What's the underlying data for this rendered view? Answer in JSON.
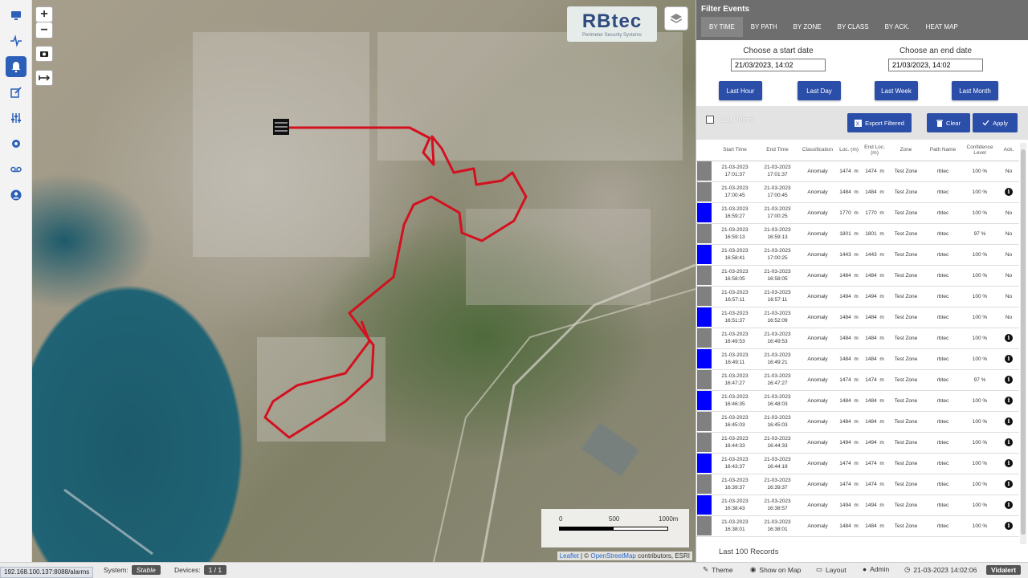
{
  "sidebar": [
    {
      "name": "monitor-icon",
      "active": false
    },
    {
      "name": "activity-icon",
      "active": false
    },
    {
      "name": "bell-icon",
      "active": true
    },
    {
      "name": "edit-icon",
      "active": false
    },
    {
      "name": "sliders-icon",
      "active": false
    },
    {
      "name": "gear-icon",
      "active": false
    },
    {
      "name": "voicemail-icon",
      "active": false
    },
    {
      "name": "user-icon",
      "active": false
    }
  ],
  "map": {
    "zoom_in": "+",
    "zoom_out": "−",
    "logo_text": "RBtec",
    "logo_sub": "Perimeter Security Systems",
    "scale": {
      "l0": "0",
      "l1": "500",
      "l2": "1000m"
    },
    "attribution": {
      "leaflet": "Leaflet",
      "sep": " | © ",
      "osm": "OpenStreetMap",
      "rest": " contributors, ESRI"
    }
  },
  "panel": {
    "title": "Filter Events",
    "tabs": [
      "BY TIME",
      "BY PATH",
      "BY ZONE",
      "BY CLASS",
      "BY ACK.",
      "HEAT MAP"
    ],
    "start": {
      "caption": "Choose a start date",
      "value": "21/03/2023, 14:02"
    },
    "end": {
      "caption": "Choose an end date",
      "value": "21/03/2023, 14:02"
    },
    "quick": [
      "Last Hour",
      "Last Day",
      "Last Week",
      "Last Month"
    ],
    "cal_points": "Cal. Points",
    "export": "Export Filtered",
    "clear": "Clear",
    "apply": "Apply",
    "footer": "Last 100 Records"
  },
  "table": {
    "headers": [
      "",
      "Start Time",
      "End Time",
      "Classification",
      "Loc. (m)",
      "End Loc. (m)",
      "Zone",
      "Path Name",
      "Confidence Level",
      "Ack."
    ],
    "rows": [
      {
        "color": "#808080",
        "start": [
          "21-03-2023",
          "17:01:37"
        ],
        "end": [
          "21-03-2023",
          "17:01:37"
        ],
        "cls": "Anomaly",
        "loc": "1474",
        "end_loc": "1474",
        "zone": "Test Zone",
        "path": "rbtec",
        "conf": "100 %",
        "ack": "No"
      },
      {
        "color": "#808080",
        "start": [
          "21-03-2023",
          "17:00:45"
        ],
        "end": [
          "21-03-2023",
          "17:00:45"
        ],
        "cls": "Anomaly",
        "loc": "1484",
        "end_loc": "1484",
        "zone": "Test Zone",
        "path": "rbtec",
        "conf": "100 %",
        "ack": "i"
      },
      {
        "color": "#0000ff",
        "start": [
          "21-03-2023",
          "16:59:27"
        ],
        "end": [
          "21-03-2023",
          "17:00:25"
        ],
        "cls": "Anomaly",
        "loc": "1770",
        "end_loc": "1770",
        "zone": "Test Zone",
        "path": "rbtec",
        "conf": "100 %",
        "ack": "No"
      },
      {
        "color": "#808080",
        "start": [
          "21-03-2023",
          "16:59:13"
        ],
        "end": [
          "21-03-2023",
          "16:59:13"
        ],
        "cls": "Anomaly",
        "loc": "1801",
        "end_loc": "1801",
        "zone": "Test Zone",
        "path": "rbtec",
        "conf": "97 %",
        "ack": "No"
      },
      {
        "color": "#0000ff",
        "start": [
          "21-03-2023",
          "16:58:41"
        ],
        "end": [
          "21-03-2023",
          "17:00:25"
        ],
        "cls": "Anomaly",
        "loc": "1443",
        "end_loc": "1443",
        "zone": "Test Zone",
        "path": "rbtec",
        "conf": "100 %",
        "ack": "No"
      },
      {
        "color": "#808080",
        "start": [
          "21-03-2023",
          "16:58:05"
        ],
        "end": [
          "21-03-2023",
          "16:58:05"
        ],
        "cls": "Anomaly",
        "loc": "1484",
        "end_loc": "1484",
        "zone": "Test Zone",
        "path": "rbtec",
        "conf": "100 %",
        "ack": "No"
      },
      {
        "color": "#808080",
        "start": [
          "21-03-2023",
          "16:57:11"
        ],
        "end": [
          "21-03-2023",
          "16:57:11"
        ],
        "cls": "Anomaly",
        "loc": "1494",
        "end_loc": "1494",
        "zone": "Test Zone",
        "path": "rbtec",
        "conf": "100 %",
        "ack": "No"
      },
      {
        "color": "#0000ff",
        "start": [
          "21-03-2023",
          "16:51:37"
        ],
        "end": [
          "21-03-2023",
          "16:52:09"
        ],
        "cls": "Anomaly",
        "loc": "1484",
        "end_loc": "1484",
        "zone": "Test Zone",
        "path": "rbtec",
        "conf": "100 %",
        "ack": "No"
      },
      {
        "color": "#808080",
        "start": [
          "21-03-2023",
          "16:49:53"
        ],
        "end": [
          "21-03-2023",
          "16:49:53"
        ],
        "cls": "Anomaly",
        "loc": "1484",
        "end_loc": "1484",
        "zone": "Test Zone",
        "path": "rbtec",
        "conf": "100 %",
        "ack": "i"
      },
      {
        "color": "#0000ff",
        "start": [
          "21-03-2023",
          "16:49:11"
        ],
        "end": [
          "21-03-2023",
          "16:49:21"
        ],
        "cls": "Anomaly",
        "loc": "1484",
        "end_loc": "1484",
        "zone": "Test Zone",
        "path": "rbtec",
        "conf": "100 %",
        "ack": "i"
      },
      {
        "color": "#808080",
        "start": [
          "21-03-2023",
          "16:47:27"
        ],
        "end": [
          "21-03-2023",
          "16:47:27"
        ],
        "cls": "Anomaly",
        "loc": "1474",
        "end_loc": "1474",
        "zone": "Test Zone",
        "path": "rbtec",
        "conf": "97 %",
        "ack": "i"
      },
      {
        "color": "#0000ff",
        "start": [
          "21-03-2023",
          "16:46:35"
        ],
        "end": [
          "21-03-2023",
          "16:48:03"
        ],
        "cls": "Anomaly",
        "loc": "1484",
        "end_loc": "1484",
        "zone": "Test Zone",
        "path": "rbtec",
        "conf": "100 %",
        "ack": "i"
      },
      {
        "color": "#808080",
        "start": [
          "21-03-2023",
          "16:45:03"
        ],
        "end": [
          "21-03-2023",
          "16:45:03"
        ],
        "cls": "Anomaly",
        "loc": "1484",
        "end_loc": "1484",
        "zone": "Test Zone",
        "path": "rbtec",
        "conf": "100 %",
        "ack": "i"
      },
      {
        "color": "#808080",
        "start": [
          "21-03-2023",
          "16:44:33"
        ],
        "end": [
          "21-03-2023",
          "16:44:33"
        ],
        "cls": "Anomaly",
        "loc": "1494",
        "end_loc": "1494",
        "zone": "Test Zone",
        "path": "rbtec",
        "conf": "100 %",
        "ack": "i"
      },
      {
        "color": "#0000ff",
        "start": [
          "21-03-2023",
          "16:43:37"
        ],
        "end": [
          "21-03-2023",
          "16:44:19"
        ],
        "cls": "Anomaly",
        "loc": "1474",
        "end_loc": "1474",
        "zone": "Test Zone",
        "path": "rbtec",
        "conf": "100 %",
        "ack": "i"
      },
      {
        "color": "#808080",
        "start": [
          "21-03-2023",
          "16:39:37"
        ],
        "end": [
          "21-03-2023",
          "16:39:37"
        ],
        "cls": "Anomaly",
        "loc": "1474",
        "end_loc": "1474",
        "zone": "Test Zone",
        "path": "rbtec",
        "conf": "100 %",
        "ack": "i"
      },
      {
        "color": "#0000ff",
        "start": [
          "21-03-2023",
          "16:38:43"
        ],
        "end": [
          "21-03-2023",
          "16:38:57"
        ],
        "cls": "Anomaly",
        "loc": "1494",
        "end_loc": "1494",
        "zone": "Test Zone",
        "path": "rbtec",
        "conf": "100 %",
        "ack": "i"
      },
      {
        "color": "#808080",
        "start": [
          "21-03-2023",
          "16:38:01"
        ],
        "end": [
          "21-03-2023",
          "16:38:01"
        ],
        "cls": "Anomaly",
        "loc": "1484",
        "end_loc": "1484",
        "zone": "Test Zone",
        "path": "rbtec",
        "conf": "100 %",
        "ack": "i"
      }
    ]
  },
  "statusbar": {
    "url": "192.168.100.137:8088/alarms",
    "system_label": "System:",
    "system_value": "Stable",
    "devices_label": "Devices:",
    "devices_value": "1 / 1",
    "theme": "Theme",
    "show_on_map": "Show on Map",
    "layout": "Layout",
    "user": "Admin",
    "datetime": "21-03-2023 14:02:06",
    "brand": "Vidalert"
  }
}
